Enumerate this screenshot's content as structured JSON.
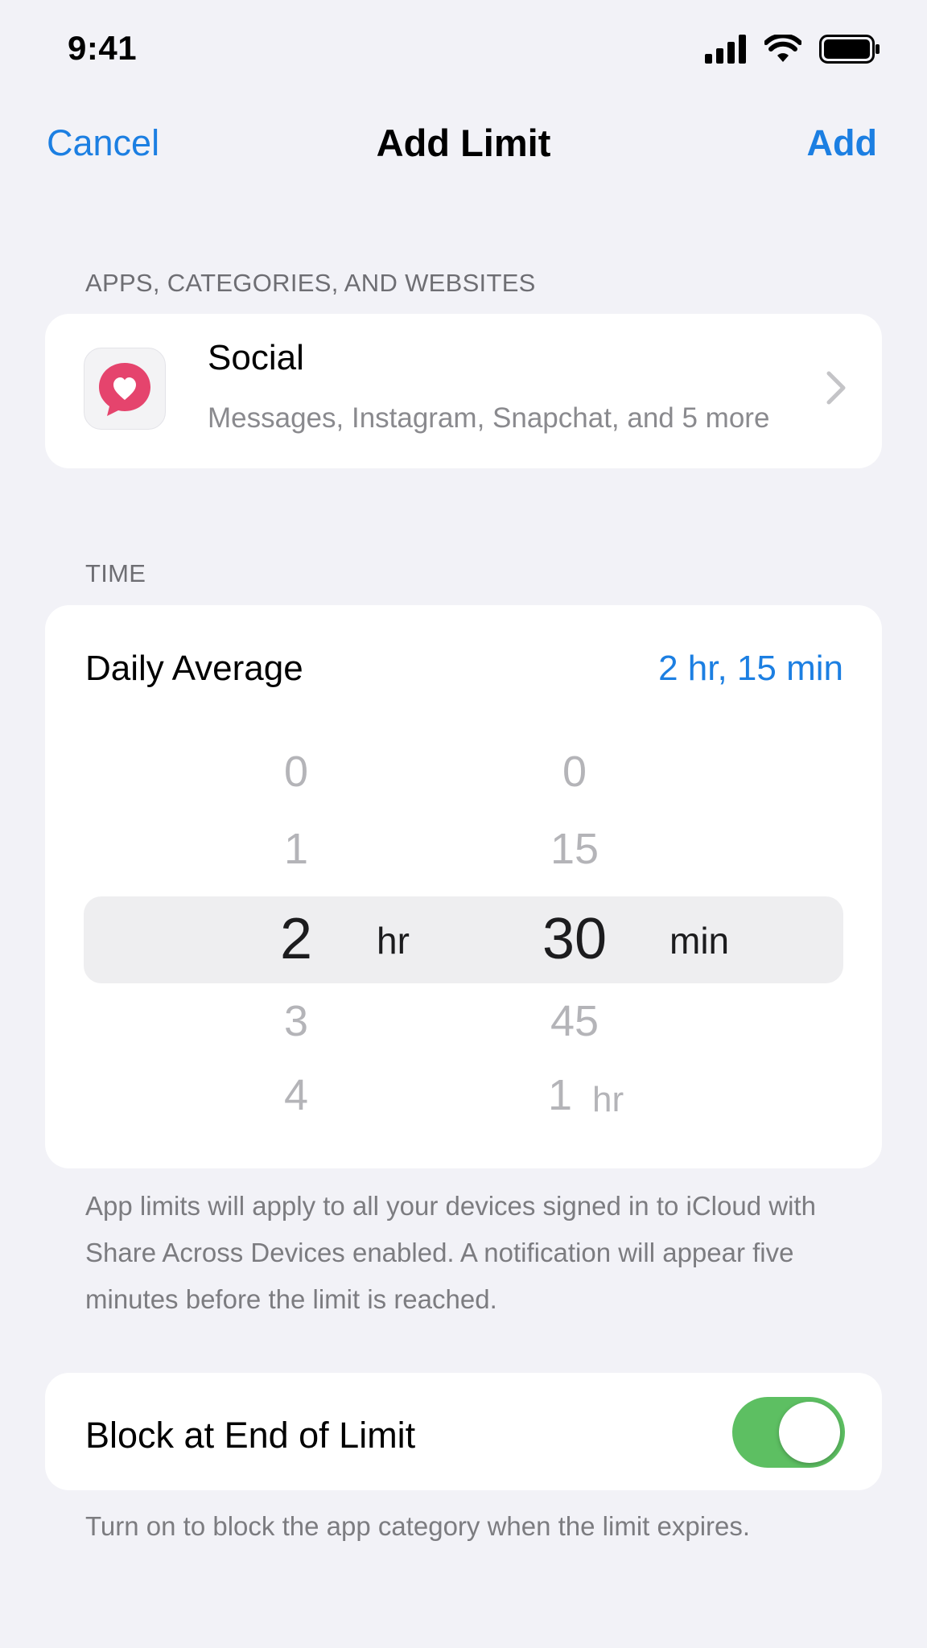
{
  "status_bar": {
    "time": "9:41"
  },
  "nav": {
    "cancel_label": "Cancel",
    "title": "Add Limit",
    "add_label": "Add"
  },
  "apps_section": {
    "header": "APPS, CATEGORIES, AND WEBSITES",
    "category": {
      "icon": "heart-bubble-icon",
      "title": "Social",
      "subtitle": "Messages, Instagram, Snapchat, and 5 more"
    }
  },
  "time_section": {
    "header": "TIME",
    "daily_average_label": "Daily Average",
    "daily_average_value": "2 hr, 15 min",
    "picker": {
      "hours": [
        "0",
        "1",
        "2",
        "3",
        "4"
      ],
      "hours_unit": "hr",
      "minutes": [
        "0",
        "15",
        "30",
        "45",
        "1"
      ],
      "minutes_unit": "min",
      "minutes_overflow_unit": "hr",
      "selected_hours": "2",
      "selected_minutes": "30"
    },
    "footer": "App limits will apply to all your devices signed in to iCloud with Share Across Devices enabled. A notification will appear five minutes before the limit is reached."
  },
  "block_section": {
    "label": "Block at End of Limit",
    "toggle_on": true,
    "footer": "Turn on to block the app category when the limit expires."
  },
  "colors": {
    "accent": "#1c7fe2",
    "toggle_on": "#5dbf62",
    "icon_pink": "#e5446d"
  }
}
